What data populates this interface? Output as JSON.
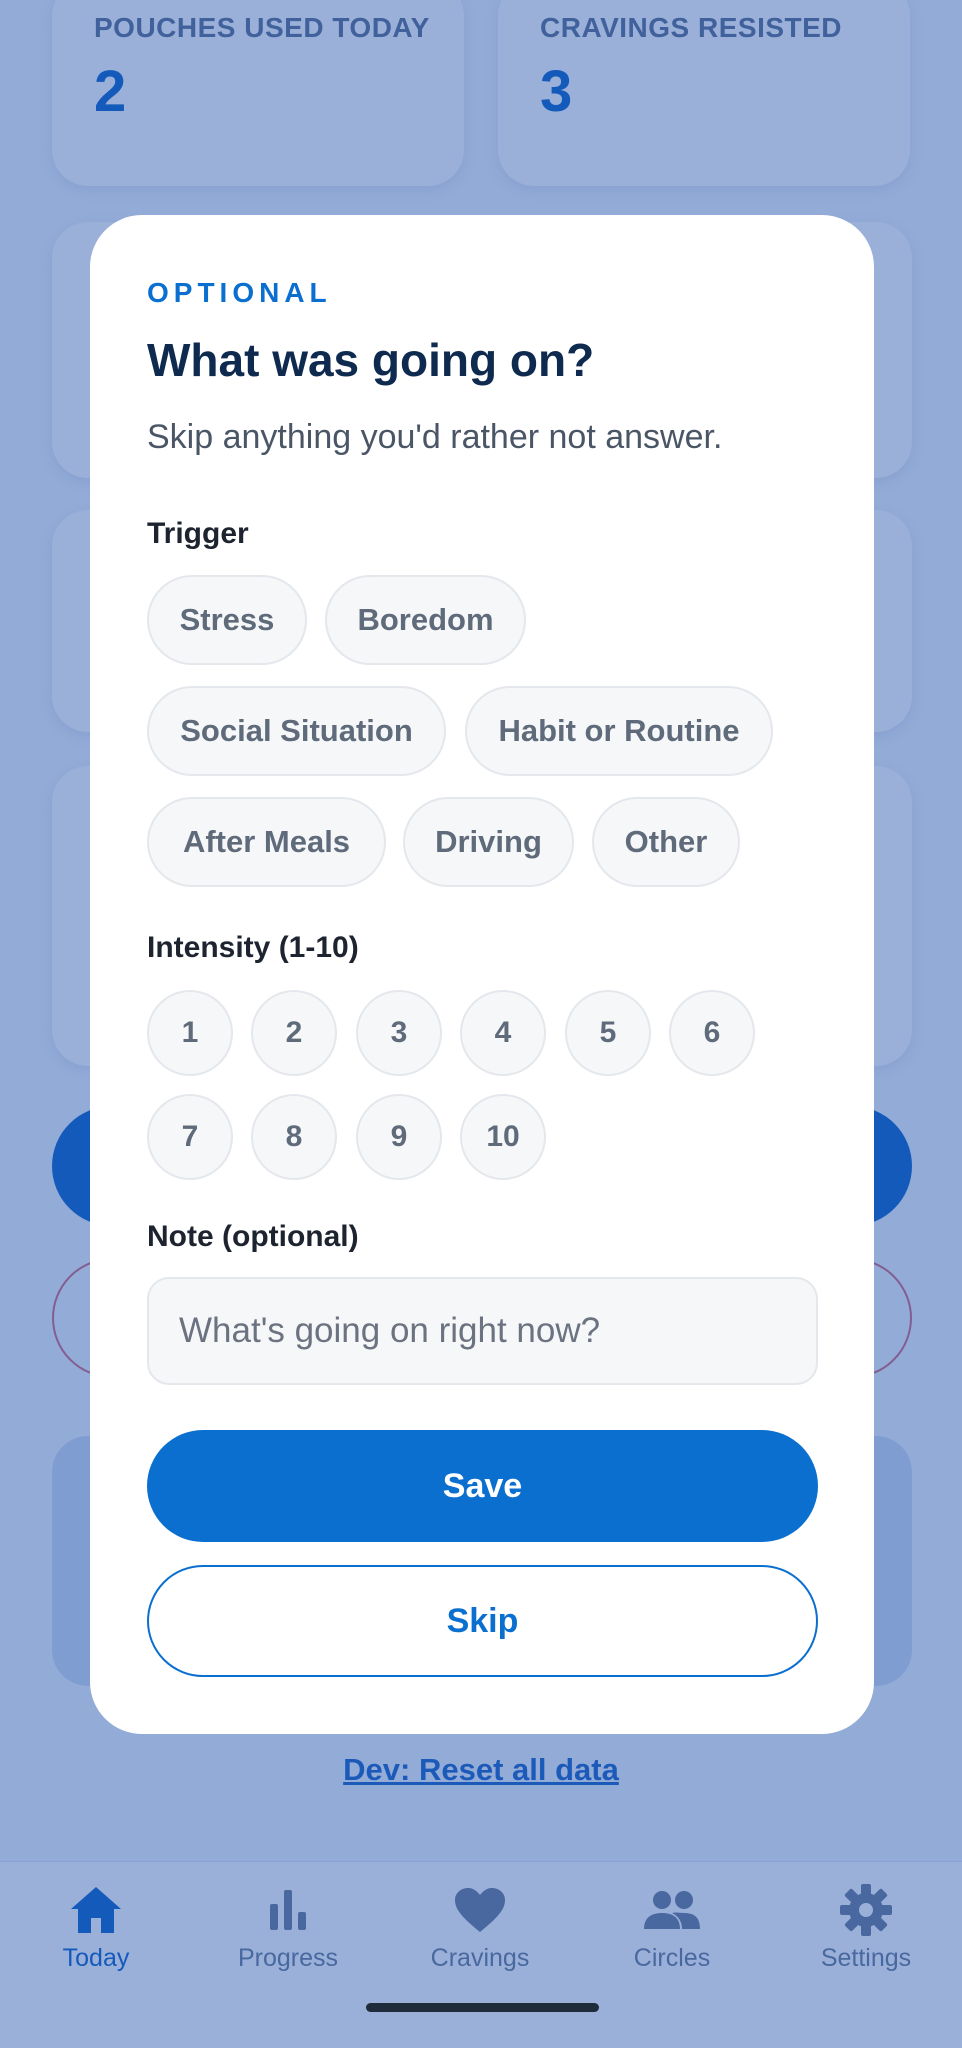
{
  "stats": [
    {
      "label": "POUCHES USED TODAY",
      "value": "2"
    },
    {
      "label": "CRAVINGS RESISTED",
      "value": "3"
    }
  ],
  "dev_link": "Dev: Reset all data",
  "tabs": [
    {
      "label": "Today",
      "icon": "home-icon",
      "active": true
    },
    {
      "label": "Progress",
      "icon": "bar-chart-icon",
      "active": false
    },
    {
      "label": "Cravings",
      "icon": "heart-icon",
      "active": false
    },
    {
      "label": "Circles",
      "icon": "people-icon",
      "active": false
    },
    {
      "label": "Settings",
      "icon": "gear-icon",
      "active": false
    }
  ],
  "modal": {
    "eyebrow": "OPTIONAL",
    "title": "What was going on?",
    "subtitle": "Skip anything you'd rather not answer.",
    "trigger_label": "Trigger",
    "triggers": [
      "Stress",
      "Boredom",
      "Social Situation",
      "Habit or Routine",
      "After Meals",
      "Driving",
      "Other"
    ],
    "intensity_label": "Intensity (1-10)",
    "intensity_values": [
      "1",
      "2",
      "3",
      "4",
      "5",
      "6",
      "7",
      "8",
      "9",
      "10"
    ],
    "note_label": "Note (optional)",
    "note_placeholder": "What's going on right now?",
    "note_value": "",
    "save_label": "Save",
    "skip_label": "Skip"
  },
  "colors": {
    "accent": "#0b6fd0",
    "title": "#0f2a4f",
    "chip_bg": "#f6f7f9",
    "chip_text": "#5f6b7a"
  }
}
